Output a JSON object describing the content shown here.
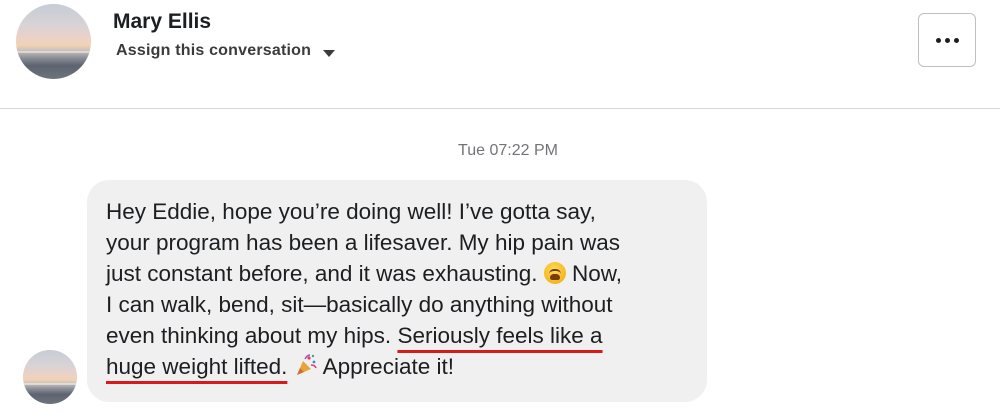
{
  "header": {
    "contact_name": "Mary Ellis",
    "assign_label": "Assign this conversation",
    "more_label": "More options"
  },
  "thread": {
    "timestamp": "Tue 07:22 PM",
    "message": {
      "line1": "Hey Eddie, hope you’re doing well! I’ve gotta say,",
      "line2": "your program has been a lifesaver. My hip pain was",
      "line3": "just constant before, and it was exhausting.",
      "line3_after_emoji": " Now,",
      "line4": "I can walk, bend, sit—basically do anything without",
      "line5_plain": "even thinking about my hips. ",
      "line5_highlight": "Seriously feels like a",
      "line6_highlight": "huge weight lifted.",
      "line6_after_emoji": " Appreciate it!",
      "emoji_1": "weary-face-icon",
      "emoji_2": "party-popper-icon"
    }
  },
  "colors": {
    "underline": "#d91a1a",
    "bubble": "#f0f0f0",
    "divider": "#d3d6db"
  }
}
